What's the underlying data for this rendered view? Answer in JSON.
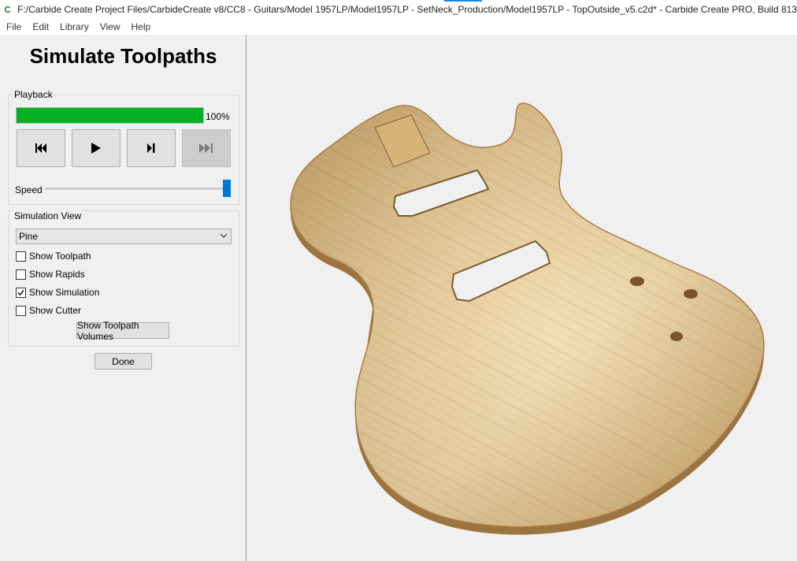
{
  "window": {
    "title": "F:/Carbide Create Project Files/CarbideCreate v8/CC8 - Guitars/Model 1957LP/Model1957LP - SetNeck_Production/Model1957LP - TopOutside_v5.c2d* - Carbide Create PRO, Build 813"
  },
  "menu": [
    "File",
    "Edit",
    "Library",
    "View",
    "Help"
  ],
  "panel": {
    "title": "Simulate Toolpaths",
    "playback": {
      "label": "Playback",
      "progress": 1.0,
      "progress_text": "100%",
      "buttons": [
        {
          "icon": "skip-to-start-icon",
          "enabled": true
        },
        {
          "icon": "play-icon",
          "enabled": true
        },
        {
          "icon": "step-forward-icon",
          "enabled": true
        },
        {
          "icon": "skip-to-end-icon",
          "enabled": false
        }
      ],
      "speed_label": "Speed",
      "speed_value": 1.0
    },
    "simulation_view": {
      "label": "Simulation View",
      "material": "Pine",
      "options": [
        {
          "label": "Show Toolpath",
          "checked": false
        },
        {
          "label": "Show Rapids",
          "checked": false
        },
        {
          "label": "Show Simulation",
          "checked": true
        },
        {
          "label": "Show Cutter",
          "checked": false
        }
      ],
      "volumes_button": "Show Toolpath Volumes"
    },
    "done_button": "Done"
  },
  "colors": {
    "progress": "#06b025",
    "slider": "#0078d7",
    "wood_light": "#e9c98c",
    "wood_dark": "#b98c4c"
  }
}
